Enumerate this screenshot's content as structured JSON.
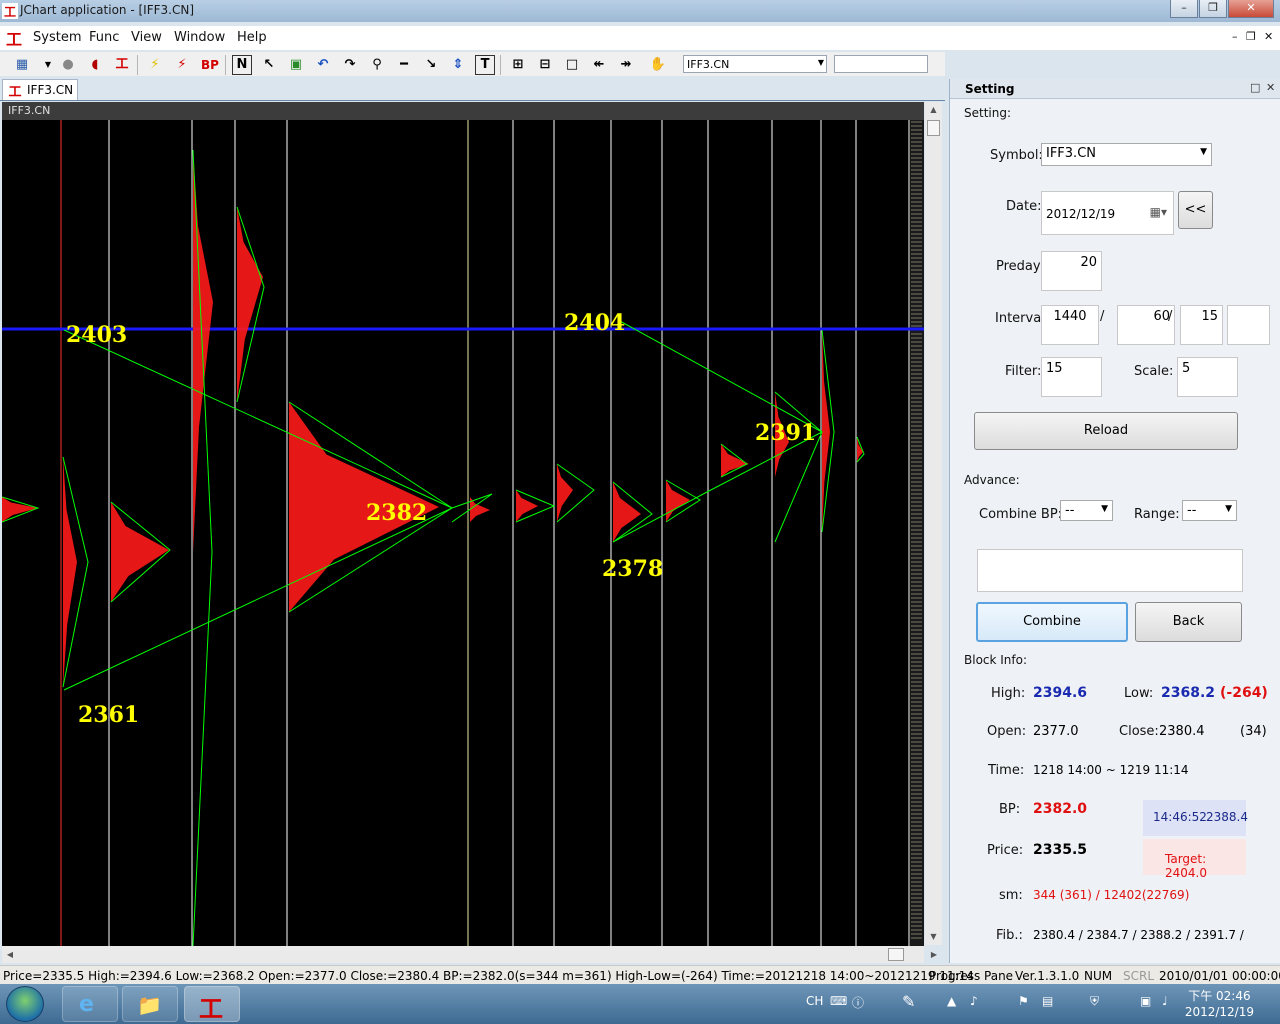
{
  "window": {
    "title": "JChart application - [IFF3.CN]"
  },
  "menu": [
    "System",
    "Func",
    "View",
    "Window",
    "Help"
  ],
  "toolbar": {
    "bp_label": "BP",
    "n_label": "N",
    "t_label": "T",
    "symbol": "IFF3.CN"
  },
  "doc_tab": {
    "label": "IFF3.CN"
  },
  "chart": {
    "header": "IFF3.CN",
    "big_labels": [
      {
        "text": "2403",
        "color": "#ffff00"
      },
      {
        "text": "2404",
        "color": "#ffff00"
      },
      {
        "text": "2382",
        "color": "#ffff00"
      },
      {
        "text": "2391",
        "color": "#ffff00"
      },
      {
        "text": "2378",
        "color": "#ffff00"
      },
      {
        "text": "2361",
        "color": "#ffff00"
      }
    ],
    "colors": {
      "background": "#000000",
      "profile": "#ff1a1a",
      "line": "#00ff00",
      "price_line": "#1a1aff",
      "grid": "#ffffff",
      "label": "#ffff00"
    }
  },
  "setting": {
    "panel_title": "Setting",
    "section_label": "Setting:",
    "symbol_label": "Symbol:",
    "symbol_value": "IFF3.CN",
    "date_label": "Date:",
    "date_value": "2012/12/19",
    "date_back": "<<",
    "preday_label": "Preday:",
    "preday_value": "20",
    "interval_label": "Interval:",
    "interval_values": [
      "1440",
      "60",
      "15",
      ""
    ],
    "interval_sep": "/",
    "filter_label": "Filter:",
    "filter_value": "15",
    "scale_label": "Scale:",
    "scale_value": "5",
    "reload": "Reload",
    "advance_label": "Advance:",
    "combine_bp_label": "Combine BP:",
    "combine_bp_value": "--",
    "range_label": "Range:",
    "range_value": "--",
    "combine": "Combine",
    "back": "Back",
    "block_info_label": "Block Info:",
    "high_label": "High:",
    "high_value": "2394.6",
    "low_label": "Low:",
    "low_value": "2368.2",
    "low_diff": "(-264)",
    "open_label": "Open:",
    "open_value": "2377.0",
    "close_label": "Close:",
    "close_value": "2380.4",
    "close_count": "(34)",
    "time_label": "Time:",
    "time_value": "1218 14:00 ~ 1219 11:14",
    "bp_label": "BP:",
    "bp_value": "2382.0",
    "quote_time": "14:46:52",
    "quote_price": "2388.4",
    "price_label": "Price:",
    "price_value": "2335.5",
    "target": "Target: 2404.0",
    "sm_label": "sm:",
    "sm_value": "344 (361) / 12402(22769)",
    "fib_label": "Fib.:",
    "fib_value": "2380.4 / 2384.7 / 2388.2 / 2391.7 /"
  },
  "status": {
    "main": "Price=2335.5  High:=2394.6  Low:=2368.2  Open:=2377.0  Close:=2380.4  BP:=2382.0(s=344 m=361)  High-Low=(-264)  Time:=20121218 14:00~20121219 11:14",
    "pane": "Progress Pane",
    "version": "Ver.1.3.1.0",
    "num": "NUM",
    "scrl": "SCRL",
    "datetime": "2010/01/01 00:00:00"
  },
  "taskbar": {
    "lang": "CH",
    "clock_time": "下午 02:46",
    "clock_date": "2012/12/19"
  }
}
